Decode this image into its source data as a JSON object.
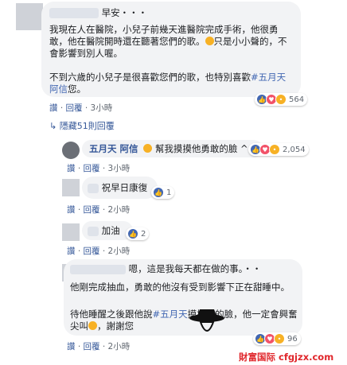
{
  "comments": {
    "c1": {
      "greeting": "早安・・・",
      "p1": "我現在人在醫院，小兒子前幾天進醫院完成手術，他很勇敢，他在醫院開時還在聽著您們的歌。",
      "p1b": "只是小小聲的，不會影響到別人喔。",
      "p2a": "不到六歲的小兒子是很喜歡您們的歌，也特別喜歡",
      "p2tag": "#五月天阿信",
      "p2b": "您。",
      "reactions": "564"
    },
    "c1meta": {
      "like": "讚",
      "sep": "·",
      "reply": "回覆",
      "time": "3小時"
    },
    "hidden_replies": "隱藏51則回覆",
    "r1": {
      "author": "五月天 阿信",
      "text": "幫我摸摸他勇敢的臉 ^ ^",
      "reactions": "2,054"
    },
    "r1meta": {
      "like": "讚",
      "reply": "回覆",
      "time": "3小時"
    },
    "r2": {
      "text": "祝早日康復",
      "reactions": "1"
    },
    "r2meta": {
      "like": "讚",
      "reply": "回覆",
      "time": "2小時"
    },
    "r3": {
      "text": "加油",
      "reactions": "2"
    },
    "r3meta": {
      "like": "讚",
      "reply": "回覆",
      "time": "2小時"
    },
    "r4": {
      "p1": "嗯，這是我每天都在做的事。・・",
      "p2": "他剛完成抽血，勇敢的他沒有受到影響下正在甜睡中。",
      "p3a": "待他睡醒之後跟他說",
      "p3tag": "#五月天",
      "p3b": "摸摸他的臉，他一定會興奮尖叫",
      "p3c": "，謝謝您",
      "reactions": "96"
    },
    "r4meta": {
      "like": "讚",
      "reply": "回覆",
      "time": "2小時"
    }
  },
  "watermark": "財富国际 cfgjzx.com",
  "colors": {
    "link": "#365899",
    "bubble": "#f2f3f5",
    "like": "#4267b2",
    "love": "#f25268",
    "wow": "#f7b125",
    "watermark": "#e0262b"
  }
}
